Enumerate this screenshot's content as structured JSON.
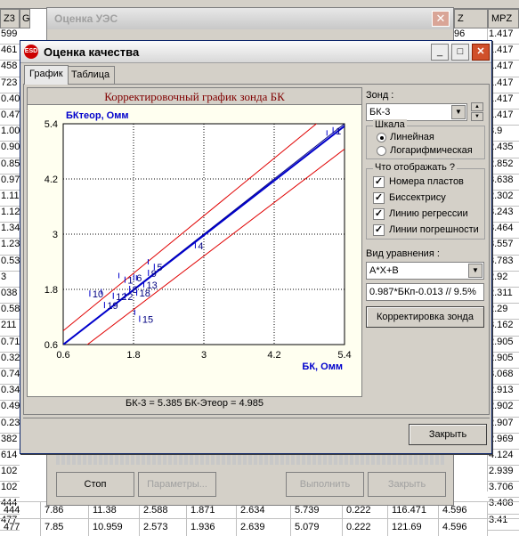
{
  "spreadsheet": {
    "header_left": "Z3",
    "header_g": "G",
    "header_z": "Z",
    "header_mpz": "MPZ",
    "left_column": [
      "599",
      "461",
      "458",
      "723",
      "0.40",
      "0.47",
      "1.00",
      "0.90",
      "0.85",
      "0.97",
      "1.11",
      "1.12",
      "1.34",
      "1.23",
      "0.53",
      "3",
      "038",
      "0.58",
      "211",
      "0.71",
      "0.32",
      "0.74",
      "0.34",
      "0.49",
      "0.23",
      "382",
      "614",
      "102",
      "102",
      "444",
      "477"
    ],
    "right_column": [
      "1.417",
      "1.417",
      "1.417",
      "1.417",
      "1.417",
      "1.417",
      "3.9",
      "2.435",
      "2.852",
      "3.638",
      "2.302",
      "3.243",
      "3.464",
      "3.557",
      "3.783",
      "2.92",
      "2.311",
      "2.29",
      "3.162",
      "2.905",
      "2.905",
      "3.068",
      "2.913",
      "2.902",
      "2.907",
      "2.969",
      "4.124",
      "2.939",
      "3.706",
      "3.408",
      "3.41"
    ],
    "right_column2": [
      "",
      "",
      "",
      "",
      "",
      "",
      "",
      "",
      "",
      "",
      "",
      "",
      "",
      "",
      "",
      "",
      "",
      "",
      "",
      "",
      "",
      "",
      "",
      "",
      "",
      "",
      "96",
      "96",
      "96",
      "596",
      "596"
    ],
    "bottom_rows": [
      [
        "444",
        "7.86",
        "11.38",
        "2.588",
        "1.871",
        "2.634",
        "5.739",
        "0.222",
        "116.471",
        "4.596"
      ],
      [
        "477",
        "7.85",
        "10.959",
        "2.573",
        "1.936",
        "2.639",
        "5.079",
        "0.222",
        "121.69",
        "4.596"
      ]
    ],
    "rows_col2": [
      "9",
      "8",
      "8"
    ]
  },
  "bg_dialog": {
    "title": "Оценка УЭС",
    "buttons": [
      "Стоп",
      "Параметры...",
      "Выполнить",
      "Закрыть"
    ]
  },
  "dialog": {
    "title": "Оценка качества",
    "tabs": [
      "График",
      "Таблица"
    ],
    "close_button": "Закрыть"
  },
  "chart_data": {
    "type": "scatter",
    "title": "Корректировочный график зонда БК",
    "ylabel": "БКтеор, Омм",
    "xlabel": "БК, Омм",
    "xlim": [
      0.6,
      5.4
    ],
    "ylim": [
      0.6,
      5.4
    ],
    "xticks": [
      "0.6",
      "1.8",
      "3",
      "4.2",
      "5.4"
    ],
    "yticks": [
      "0.6",
      "1.8",
      "3",
      "4.2",
      "5.4"
    ],
    "grid": true,
    "points": [
      {
        "x": 1.1,
        "y": 1.7,
        "label": "10"
      },
      {
        "x": 1.35,
        "y": 1.45,
        "label": "19"
      },
      {
        "x": 1.5,
        "y": 1.65,
        "label": "12"
      },
      {
        "x": 1.7,
        "y": 1.65,
        "label": "2"
      },
      {
        "x": 1.78,
        "y": 1.8,
        "label": "8"
      },
      {
        "x": 1.9,
        "y": 1.72,
        "label": "18"
      },
      {
        "x": 2.02,
        "y": 1.9,
        "label": "13"
      },
      {
        "x": 1.7,
        "y": 2.0,
        "label": "1"
      },
      {
        "x": 1.85,
        "y": 2.05,
        "label": "6"
      },
      {
        "x": 2.1,
        "y": 2.15,
        "label": "9"
      },
      {
        "x": 2.2,
        "y": 2.28,
        "label": "5"
      },
      {
        "x": 2.9,
        "y": 2.75,
        "label": "4"
      },
      {
        "x": 1.95,
        "y": 1.15,
        "label": "15"
      },
      {
        "x": 5.25,
        "y": 5.25,
        "label": "1"
      }
    ],
    "ticks_marks": [
      [
        1.25,
        1.75
      ],
      [
        1.82,
        1.3
      ],
      [
        1.85,
        2.05
      ],
      [
        2.05,
        2.4
      ],
      [
        1.55,
        2.1
      ],
      [
        5.1,
        5.2
      ]
    ],
    "regression_line": [
      [
        0.6,
        0.6
      ],
      [
        5.4,
        5.35
      ]
    ],
    "bisector_line": [
      [
        0.6,
        0.6
      ],
      [
        5.4,
        5.4
      ]
    ],
    "error_upper": [
      [
        0.6,
        0.9
      ],
      [
        5.4,
        5.9
      ]
    ],
    "error_lower": [
      [
        0.6,
        0.2
      ],
      [
        5.4,
        4.85
      ]
    ],
    "status_text": "БК-3 = 5.385  БК-Этеор = 4.985"
  },
  "right_panel": {
    "zond_label": "Зонд :",
    "zond_value": "БК-3",
    "scale_label": "Шкала",
    "scale_linear": "Линейная",
    "scale_log": "Логарифмическая",
    "show_label": "Что отображать ?",
    "show_numbers": "Номера пластов",
    "show_bisector": "Биссектрису",
    "show_regression": "Линию регрессии",
    "show_errors": "Линии погрешности",
    "equation_label": "Вид уравнения :",
    "equation_value": "A*X+B",
    "formula_value": "0.987*БКп-0.013 // 9.5%",
    "correct_button": "Корректировка зонда"
  },
  "colors": {
    "regression": "#0000cc",
    "bisector": "#000080",
    "errors": "#e00000",
    "grid": "#000000",
    "title": "#800000"
  }
}
